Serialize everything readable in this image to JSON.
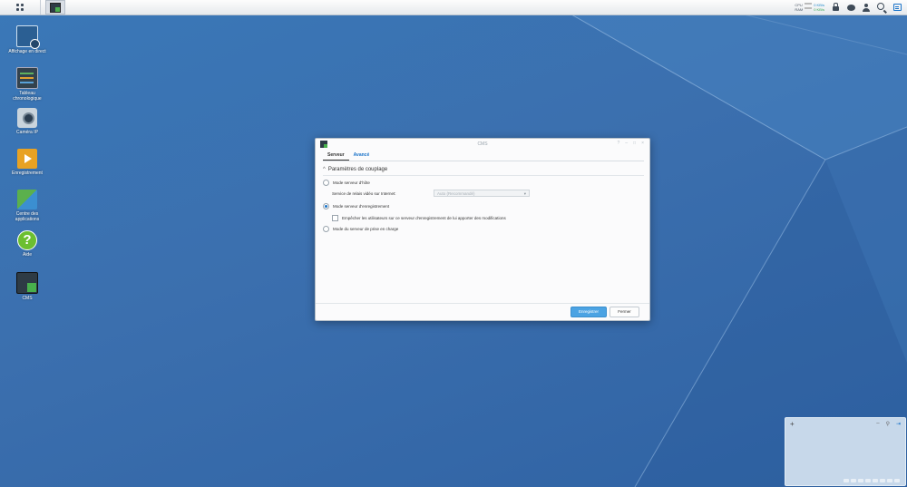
{
  "taskbar": {
    "main_menu_icon": "grid-menu-icon",
    "running_app_icon": "cms-icon",
    "resource_monitor": {
      "cpu_label": "CPU",
      "ram_label": "RAM",
      "upload": "0 KB/s",
      "download": "0 KB/s"
    },
    "tray_icons": [
      "lock-icon",
      "chat-icon",
      "user-icon",
      "search-icon",
      "widget-icon"
    ]
  },
  "desktop": {
    "icons": [
      {
        "label": "Affichage en direct",
        "icon": "live-view-icon"
      },
      {
        "label": "Tableau chronologique",
        "icon": "timeline-icon"
      },
      {
        "label": "Caméra IP",
        "icon": "ip-camera-icon"
      },
      {
        "label": "Enregistrement",
        "icon": "recording-icon"
      },
      {
        "label": "Centre des applications",
        "icon": "application-center-icon"
      },
      {
        "label": "Aide",
        "icon": "help-icon"
      },
      {
        "label": "CMS",
        "icon": "cms-icon"
      }
    ]
  },
  "window": {
    "title": "CMS",
    "controls": [
      "?",
      "–",
      "□",
      "×"
    ],
    "tabs": [
      {
        "label": "Serveur",
        "active": true
      },
      {
        "label": "Avancé",
        "active": false
      }
    ],
    "section_title": "Paramètres de couplage",
    "section_toggle": "^",
    "options": {
      "host_mode": {
        "label": "Mode serveur d'hôte",
        "selected": false
      },
      "relay_label": "Service de relais vidéo sur Internet:",
      "relay_value": "Auto (Recommandé)",
      "recording_mode": {
        "label": "Mode serveur d'enregistrement",
        "selected": true
      },
      "prevent_users": {
        "label": "Empêcher les utilisateurs sur ce serveur d'enregistrement de lui apporter des modifications",
        "checked": false
      },
      "failover_mode": {
        "label": "Mode du serveur de prise en charge",
        "selected": false
      }
    },
    "buttons": {
      "save": "Enregistrer",
      "close": "Fermer"
    }
  },
  "notification_panel": {
    "add": "+",
    "controls": [
      "–",
      "⚲",
      "⇥"
    ]
  },
  "colors": {
    "desktop": "#3b6fae",
    "accent": "#1a73c9",
    "primary_button": "#4ba3e3"
  }
}
